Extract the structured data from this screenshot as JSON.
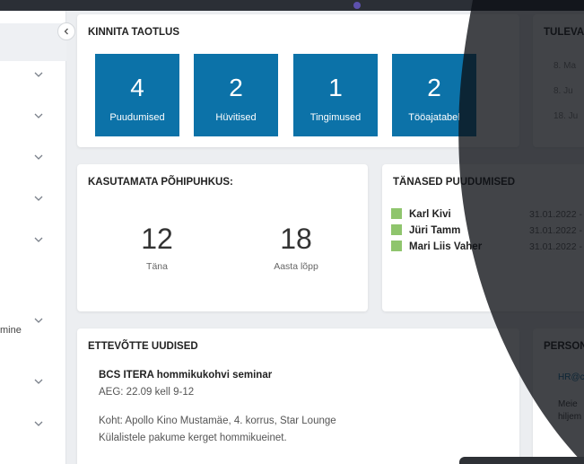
{
  "colors": {
    "tile": "#0c72a8",
    "absence_marker": "#8fc56d",
    "overlay": "#0d0f14"
  },
  "sidebar": {
    "item_label": "mine"
  },
  "approve": {
    "title": "KINNITA TAOTLUS",
    "tiles": [
      {
        "count": "4",
        "label": "Puudumised"
      },
      {
        "count": "2",
        "label": "Hüvitised"
      },
      {
        "count": "1",
        "label": "Tingimused"
      },
      {
        "count": "2",
        "label": "Tööajatabel"
      }
    ]
  },
  "upcoming": {
    "title": "TULEVA",
    "items": [
      "8. Ma",
      "8. Ju",
      "18. Ju"
    ]
  },
  "vacation": {
    "title": "KASUTAMATA PÕHIPUHKUS:",
    "today_value": "12",
    "today_label": "Täna",
    "yearend_value": "18",
    "yearend_label": "Aasta lõpp"
  },
  "absences": {
    "title": "TÄNASED PUUDUMISED",
    "rows": [
      {
        "name": "Karl Kivi",
        "date": "31.01.2022 -"
      },
      {
        "name": "Jüri Tamm",
        "date": "31.01.2022 -"
      },
      {
        "name": "Mari Liis Vaher",
        "date": "31.01.2022 -"
      }
    ]
  },
  "news": {
    "title": "ETTEVÕTTE UUDISED",
    "headline": "BCS ITERA hommikukohvi seminar",
    "time": "AEG: 22.09 kell 9-12",
    "place": "Koht: Apollo Kino Mustamäe, 4. korrus, Star Lounge",
    "note": "Külalistele pakume kerget hommikueinet."
  },
  "personnel": {
    "title": "PERSON",
    "email": "HR@c",
    "text1": "Meie",
    "text2": "hiljem"
  }
}
